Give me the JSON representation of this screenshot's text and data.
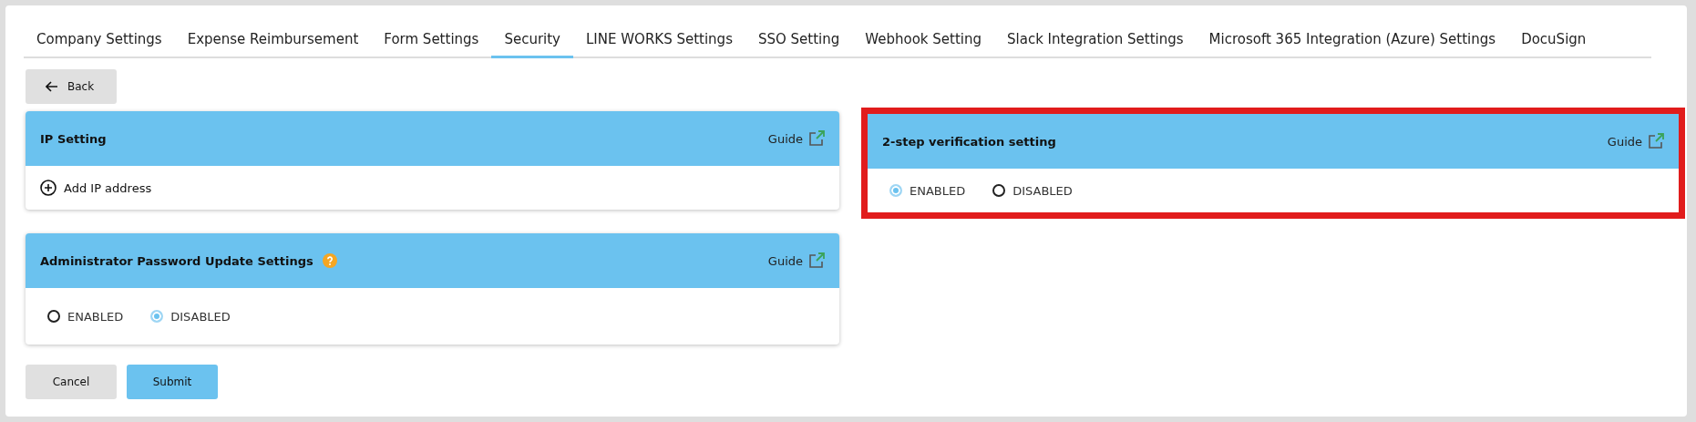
{
  "tabs": [
    {
      "label": "Company Settings",
      "selected": false
    },
    {
      "label": "Expense Reimbursement",
      "selected": false
    },
    {
      "label": "Form Settings",
      "selected": false
    },
    {
      "label": "Security",
      "selected": true
    },
    {
      "label": "LINE WORKS Settings",
      "selected": false
    },
    {
      "label": "SSO Setting",
      "selected": false
    },
    {
      "label": "Webhook Setting",
      "selected": false
    },
    {
      "label": "Slack Integration Settings",
      "selected": false
    },
    {
      "label": "Microsoft 365 Integration (Azure) Settings",
      "selected": false
    },
    {
      "label": "DocuSign",
      "selected": false
    }
  ],
  "back_button": "Back",
  "left_cards": [
    {
      "title": "IP Setting",
      "help": false,
      "guide": "Guide",
      "highlighted": false,
      "kind": "add",
      "add_label": "Add IP address"
    },
    {
      "title": "Administrator Password Update Settings",
      "help": true,
      "guide": "Guide",
      "highlighted": false,
      "kind": "radio",
      "options": [
        {
          "label": "ENABLED",
          "selected": false
        },
        {
          "label": "DISABLED",
          "selected": true
        }
      ]
    }
  ],
  "right_cards": [
    {
      "title": "2-step verification setting",
      "help": false,
      "guide": "Guide",
      "highlighted": true,
      "kind": "radio",
      "options": [
        {
          "label": "ENABLED",
          "selected": true
        },
        {
          "label": "DISABLED",
          "selected": false
        }
      ]
    }
  ],
  "footer_buttons": [
    {
      "label": "Cancel",
      "kind": "secondary"
    },
    {
      "label": "Submit",
      "kind": "primary"
    }
  ]
}
